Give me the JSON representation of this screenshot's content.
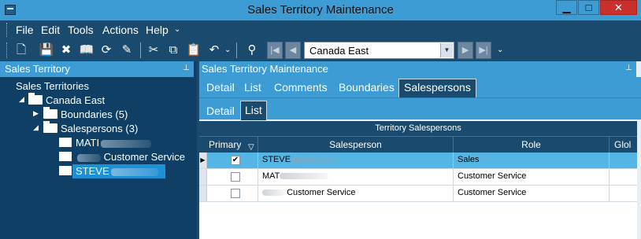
{
  "window": {
    "title": "Sales Territory Maintenance",
    "minimize_glyph": "▁",
    "maximize_glyph": "□",
    "close_glyph": "✕"
  },
  "menu": {
    "items": [
      "File",
      "Edit",
      "Tools",
      "Actions",
      "Help"
    ],
    "overflow_glyph": "⌄"
  },
  "toolbar": {
    "icons": [
      "new-icon",
      "save-icon",
      "delete-icon",
      "open-book-icon",
      "refresh-icon",
      "brush-icon",
      "cut-icon",
      "copy-icon",
      "paste-icon",
      "undo-icon",
      "binoculars-icon"
    ],
    "nav_first": "|◀",
    "nav_prev": "◀",
    "nav_next": "▶",
    "nav_last": "▶|",
    "territory_select": "Canada East",
    "overflow_glyph": "⌄"
  },
  "left_pane": {
    "title": "Sales Territory",
    "pin_glyph": "⊥",
    "tree": {
      "root": "Sales Territories",
      "territory": "Canada East",
      "boundaries": "Boundaries (5)",
      "salespersons": "Salespersons (3)",
      "people": [
        {
          "name": "MATI",
          "suffix": ""
        },
        {
          "name": "",
          "suffix": "Customer Service"
        },
        {
          "name": "STEVE",
          "suffix": ""
        }
      ]
    }
  },
  "right_pane": {
    "title": "Sales Territory Maintenance",
    "pin_glyph": "⊥",
    "main_tabs": [
      "Detail",
      "List",
      "Comments",
      "Boundaries",
      "Salespersons"
    ],
    "active_main_tab": "Salespersons",
    "sub_tabs": [
      "Detail",
      "List"
    ],
    "active_sub_tab": "List",
    "grid": {
      "title": "Territory Salespersons",
      "columns": [
        "Primary",
        "Salesperson",
        "Role",
        "Glol"
      ],
      "rows": [
        {
          "primary": true,
          "salesperson": "STEVE",
          "role": "Sales",
          "selected": true
        },
        {
          "primary": false,
          "salesperson": "MAT",
          "role": "Customer Service",
          "selected": false
        },
        {
          "primary": false,
          "salesperson": "Customer Service",
          "role": "Customer Service",
          "selected": false
        }
      ]
    }
  },
  "colors": {
    "title_bar": "#3d9cd3",
    "dark_panel": "#1a4a6e",
    "tree_bg": "#0f3f64",
    "selection": "#55b6e6",
    "close_button": "#c9302c"
  }
}
